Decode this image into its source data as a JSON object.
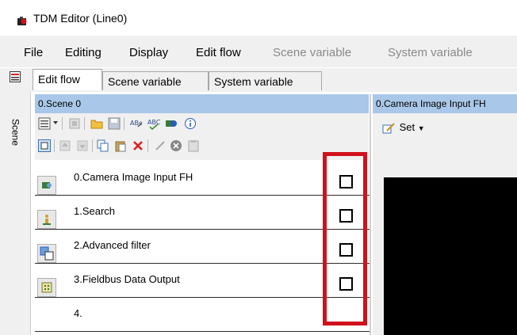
{
  "window": {
    "title": "TDM Editor (Line0)"
  },
  "menu": {
    "items": [
      {
        "label": "File",
        "enabled": true
      },
      {
        "label": "Editing",
        "enabled": true
      },
      {
        "label": "Display",
        "enabled": true
      },
      {
        "label": "Edit flow",
        "enabled": true
      },
      {
        "label": "Scene variable",
        "enabled": false
      },
      {
        "label": "System variable",
        "enabled": false
      }
    ]
  },
  "side_strip": {
    "label": "Scene"
  },
  "tabs": [
    {
      "label": "Edit flow",
      "active": true
    },
    {
      "label": "Scene variable",
      "active": false
    },
    {
      "label": "System variable",
      "active": false
    }
  ],
  "scene_panel": {
    "header": "0.Scene 0",
    "flow_items": [
      {
        "label": "0.Camera Image Input FH",
        "icon": "camera-input-icon",
        "checked": false
      },
      {
        "label": "1.Search",
        "icon": "search-unit-icon",
        "checked": false
      },
      {
        "label": "2.Advanced filter",
        "icon": "filter-icon",
        "checked": false
      },
      {
        "label": "3.Fieldbus Data Output",
        "icon": "fieldbus-output-icon",
        "checked": false
      },
      {
        "label": "4.",
        "icon": "",
        "checked": null
      }
    ]
  },
  "right_panel": {
    "header": "0.Camera Image Input FH",
    "set_label": "Set"
  },
  "colors": {
    "header_blue": "#a9c7e8",
    "highlight_red": "#d0111c",
    "toolbar_bg": "#f0f0f0"
  }
}
